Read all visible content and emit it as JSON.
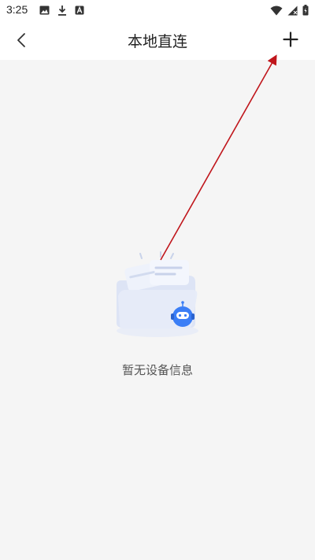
{
  "status_bar": {
    "time": "3:25",
    "left_icons": [
      "image-icon",
      "download-icon",
      "a-badge-icon"
    ],
    "right_icons": [
      "wifi-icon",
      "signal-icon",
      "battery-icon"
    ]
  },
  "app_bar": {
    "title": "本地直连",
    "back_icon": "chevron-left-icon",
    "add_icon": "plus-icon"
  },
  "empty_state": {
    "illustration": "empty-folder-robot-illustration",
    "message": "暂无设备信息"
  },
  "annotation": {
    "color": "#c0161c"
  },
  "colors": {
    "background": "#f5f5f5",
    "bar_background": "#ffffff",
    "robot_blue": "#3b7ef6"
  }
}
